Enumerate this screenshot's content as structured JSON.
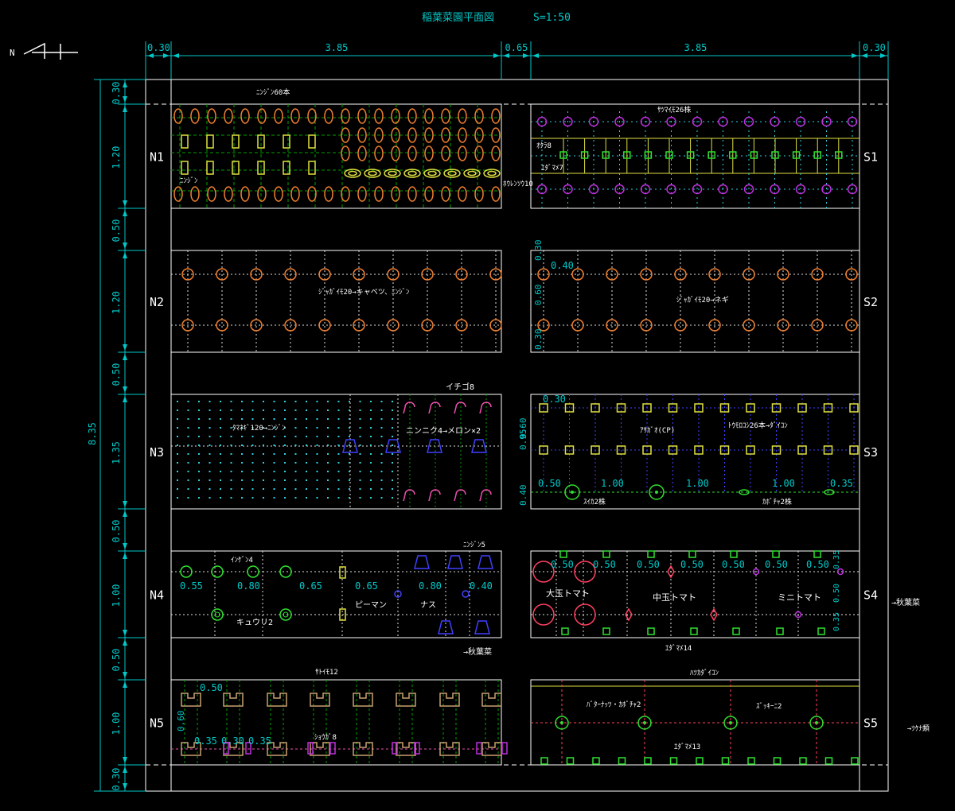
{
  "title": "稲葉菜園平面図",
  "scale": "S=1:50",
  "north_mark": "N",
  "colors": {
    "dim": "#00c8c8",
    "frame": "#ffffff",
    "orange": "#f08030",
    "yellow": "#e0e040",
    "green": "#30e030",
    "purple": "#c030e0",
    "cyan": "#30d0e0",
    "pink": "#f050b0",
    "blue": "#4040ff",
    "red": "#ff4060",
    "tan": "#c8a070",
    "gridgreen": "#00a000",
    "gridwhite": "#e0e0e0"
  },
  "top_dims": [
    "0.30",
    "3.85",
    "0.65",
    "3.85",
    "0.30"
  ],
  "left_dims": [
    "0.30",
    "1.20",
    "0.50",
    "1.20",
    "0.50",
    "1.35",
    "0.50",
    "1.00",
    "0.50",
    "1.00",
    "0.30"
  ],
  "total_height": "8.35",
  "beds_left": [
    "N1",
    "N2",
    "N3",
    "N4",
    "N5"
  ],
  "beds_right": [
    "S1",
    "S2",
    "S3",
    "S4",
    "S5"
  ],
  "labels": {
    "n1_top": "ﾆﾝｼﾞﾝ60本",
    "n1_side": "ﾆﾝｼﾞﾝ",
    "n1_right": "ﾎｳﾚﾝｿｳ10",
    "s1_top": "ｻﾂﾏｲﾓ26株",
    "s1_okra": "ｵｸﾗ8",
    "s1_edamame": "ｴﾀﾞﾏﾒ7",
    "n2_center": "ｼﾞｬｶﾞｲﾓ20→キャベツ、ﾆﾝｼﾞﾝ",
    "s2_center": "ｼﾞｬｶﾞｲﾓ20→ネギ",
    "n3_strawberry": "イチゴ8",
    "n3_onion": "ﾀﾏﾈｷﾞ120→ﾆﾝｼﾞﾝ",
    "n3_garlic": "ニンニク4→メロン×2",
    "s3_morning": "ｱｻｶﾞｵ(CP)",
    "s3_corn": "ﾄｳﾓﾛｺｼ26本→ﾀﾞｲｺﾝ",
    "s3_watermelon": "ｽｲｶ2株",
    "s3_squash": "ｶﾎﾞﾁｬ2株",
    "n4_kidney": "ｲﾝｹﾞﾝ4",
    "n4_cucumber": "キュウリ2",
    "n4_pepper": "ピーマン",
    "n4_eggplant": "ナス",
    "n4_carrot": "ﾆﾝｼﾞﾝ5",
    "s4_big": "大玉トマト",
    "s4_mid": "中玉トマト",
    "s4_mini": "ミニトマト",
    "s4_edamame": "ｴﾀﾞﾏﾒ14",
    "autumn1": "→秋葉菜",
    "autumn2": "→秋葉菜",
    "n5_potato": "ｻﾄｲﾓ12",
    "n5_ginger": "ｼｮｳｶﾞ8",
    "s5_top": "ﾊﾂｶﾀﾞｲｺﾝ",
    "s5_mid1": "ﾊﾞﾀｰﾅｯﾂ・ｶﾎﾞﾁｬ2",
    "s5_mid2": "ｽﾞｯｷｰﾆ2",
    "s5_bottom": "ｴﾀﾞﾏﾒ13",
    "s5_side": "→ﾂｹﾅ類"
  },
  "inner_dims": {
    "s2": [
      "0.30",
      "0.40",
      "0.60",
      "0.30"
    ],
    "s3_top": "0.30",
    "s3_side": [
      "0.60",
      "0.95",
      "0.40"
    ],
    "s3_row": [
      "0.50",
      "1.00",
      "1.00",
      "1.00",
      "0.35"
    ],
    "n4_row": [
      "0.55",
      "0.80",
      "0.65",
      "0.65",
      "0.80",
      "0.40"
    ],
    "s4_row": [
      "0.50",
      "0.50",
      "0.50",
      "0.50",
      "0.50",
      "0.50",
      "0.50"
    ],
    "s4_side": [
      "0.35",
      "0.50",
      "0.35"
    ],
    "n5_top": "0.50",
    "n5_side": "0.60",
    "n5_row": [
      "0.35",
      "0.30",
      "0.35"
    ]
  }
}
